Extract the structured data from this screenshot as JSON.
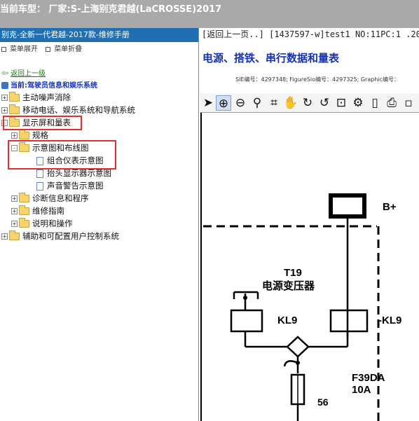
{
  "header": {
    "title": "当前车型：  厂家:S-上海别克君越(LaCROSSE)2017"
  },
  "left_panel": {
    "head": "别克-全新一代君越-2017款-维修手册",
    "toolbar": {
      "expand": "菜单展开",
      "collapse": "菜单折叠"
    },
    "back_link": "返回上一级",
    "current": "当前:驾驶员信息和娱乐系统",
    "tree": [
      {
        "label": "主动噪声消除",
        "toggle": "+"
      },
      {
        "label": "移动电话、娱乐系统和导航系统",
        "toggle": "+"
      },
      {
        "label": "显示屏和量表",
        "toggle": "-"
      },
      {
        "label": "规格",
        "toggle": "+"
      },
      {
        "label": "示意图和布线图",
        "toggle": "-"
      },
      {
        "label": "组合仪表示意图",
        "toggle": ""
      },
      {
        "label": "抬头显示器示意图",
        "toggle": ""
      },
      {
        "label": "声音警告示意图",
        "toggle": ""
      },
      {
        "label": "诊断信息和程序",
        "toggle": "+"
      },
      {
        "label": "维修指南",
        "toggle": "+"
      },
      {
        "label": "说明和操作",
        "toggle": "+"
      },
      {
        "label": "辅助和可配置用户控制系统",
        "toggle": "+"
      }
    ]
  },
  "right_panel": {
    "nav_line": "[返回上一页..] [1437597-w]test1 NO:11PC:1 .20",
    "page_title": "电源、搭铁、串行数据和量表",
    "meta": "SIE编号：4297348;  FigureSio编号：4297325;  Graphic编号：",
    "tools": [
      "pointer-icon",
      "zoom-in-icon",
      "zoom-out-icon",
      "search-icon",
      "crop-icon",
      "pan-hand-icon",
      "redo-icon",
      "rotate-icon",
      "fit-icon",
      "settings-icon",
      "page-icon",
      "print-icon",
      "more-icon"
    ],
    "diagram": {
      "b_plus": "B+",
      "t19": "T19",
      "transformer": "电源变压器",
      "kl9_left": "KL9",
      "kl9_right": "-KL9",
      "fuse": "F39DA",
      "amp": "10A",
      "wire": "56"
    }
  }
}
